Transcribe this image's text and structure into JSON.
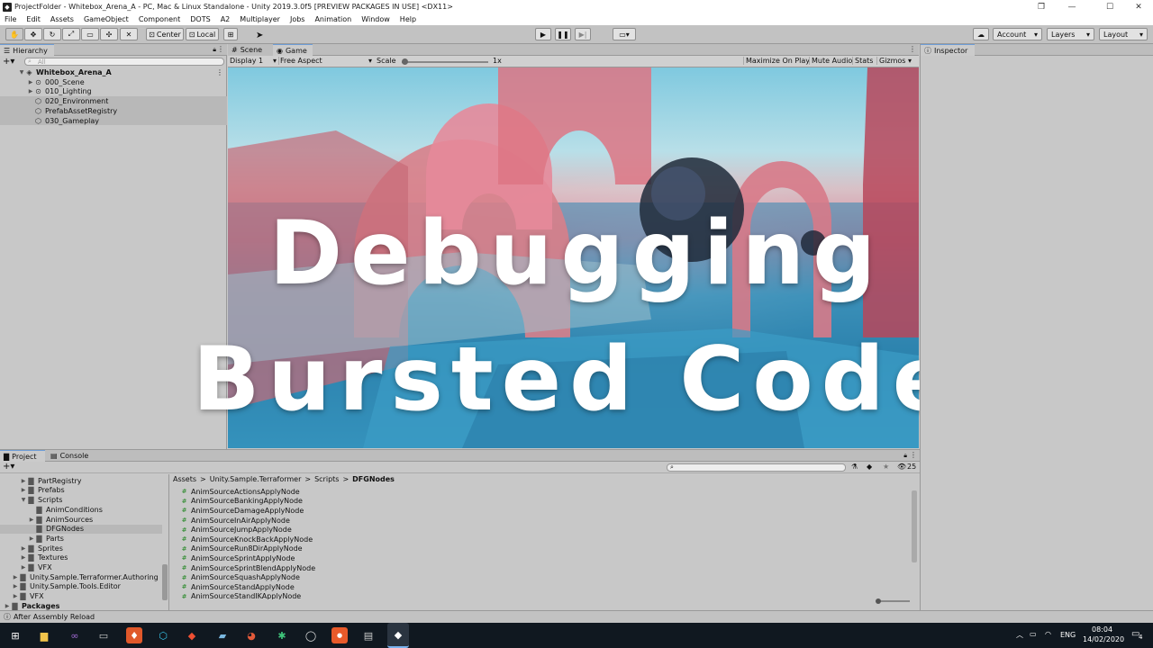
{
  "window": {
    "title": "ProjectFolder - Whitebox_Arena_A - PC, Mac & Linux Standalone - Unity 2019.3.0f5 [PREVIEW PACKAGES IN USE] <DX11>",
    "controls": {
      "restore": "❐",
      "minimize": "—",
      "maximize": "☐",
      "close": "✕"
    }
  },
  "menu": [
    "File",
    "Edit",
    "Assets",
    "GameObject",
    "Component",
    "DOTS",
    "A2",
    "Multiplayer",
    "Jobs",
    "Animation",
    "Window",
    "Help"
  ],
  "toolbar": {
    "pivot": "Center",
    "space": "Local",
    "account": "Account",
    "layers": "Layers",
    "layout": "Layout"
  },
  "hierarchy": {
    "tab": "Hierarchy",
    "search_placeholder": "All",
    "scene": "Whitebox_Arena_A",
    "items": [
      {
        "label": "000_Scene"
      },
      {
        "label": "010_Lighting"
      },
      {
        "label": "020_Environment"
      },
      {
        "label": "PrefabAssetRegistry"
      },
      {
        "label": "030_Gameplay"
      }
    ]
  },
  "game": {
    "tabs": [
      "Scene",
      "Game"
    ],
    "display": "Display 1",
    "aspect": "Free Aspect",
    "scale_label": "Scale",
    "scale_value": "1x",
    "scale_fraction": 0.0,
    "buttons": [
      "Maximize On Play",
      "Mute Audio",
      "Stats",
      "Gizmos"
    ]
  },
  "overlay": {
    "line1": "Debugging",
    "line2": "Bursted Code"
  },
  "inspector": {
    "tab": "Inspector"
  },
  "project": {
    "tabs": [
      "Project",
      "Console"
    ],
    "hidden_count": "25",
    "breadcrumb": [
      "Assets",
      "Unity.Sample.Terraformer",
      "Scripts",
      "DFGNodes"
    ],
    "tree": [
      {
        "label": "PartRegistry",
        "indent": 2,
        "expand": true
      },
      {
        "label": "Prefabs",
        "indent": 2,
        "expand": true
      },
      {
        "label": "Scripts",
        "indent": 2,
        "expand": true,
        "open": true
      },
      {
        "label": "AnimConditions",
        "indent": 3,
        "expand": false
      },
      {
        "label": "AnimSources",
        "indent": 3,
        "expand": true
      },
      {
        "label": "DFGNodes",
        "indent": 3,
        "expand": false,
        "selected": true
      },
      {
        "label": "Parts",
        "indent": 3,
        "expand": true
      },
      {
        "label": "Sprites",
        "indent": 2,
        "expand": true
      },
      {
        "label": "Textures",
        "indent": 2,
        "expand": true
      },
      {
        "label": "VFX",
        "indent": 2,
        "expand": true
      },
      {
        "label": "Unity.Sample.Terraformer.Authoring",
        "indent": 1,
        "expand": true
      },
      {
        "label": "Unity.Sample.Tools.Editor",
        "indent": 1,
        "expand": true
      },
      {
        "label": "VFX",
        "indent": 1,
        "expand": true
      },
      {
        "label": "Packages",
        "indent": 0,
        "expand": true,
        "bold": true
      }
    ],
    "files": [
      "AnimSourceActionsApplyNode",
      "AnimSourceBankingApplyNode",
      "AnimSourceDamageApplyNode",
      "AnimSourceInAirApplyNode",
      "AnimSourceJumpApplyNode",
      "AnimSourceKnockBackApplyNode",
      "AnimSourceRun8DirApplyNode",
      "AnimSourceSprintApplyNode",
      "AnimSourceSprintBlendApplyNode",
      "AnimSourceSquashApplyNode",
      "AnimSourceStandApplyNode",
      "AnimSourceStandIKApplyNode"
    ]
  },
  "status": "After Assembly Reload",
  "taskbar": {
    "lang": "ENG",
    "time": "08:04",
    "date": "14/02/2020",
    "notif": "4"
  }
}
